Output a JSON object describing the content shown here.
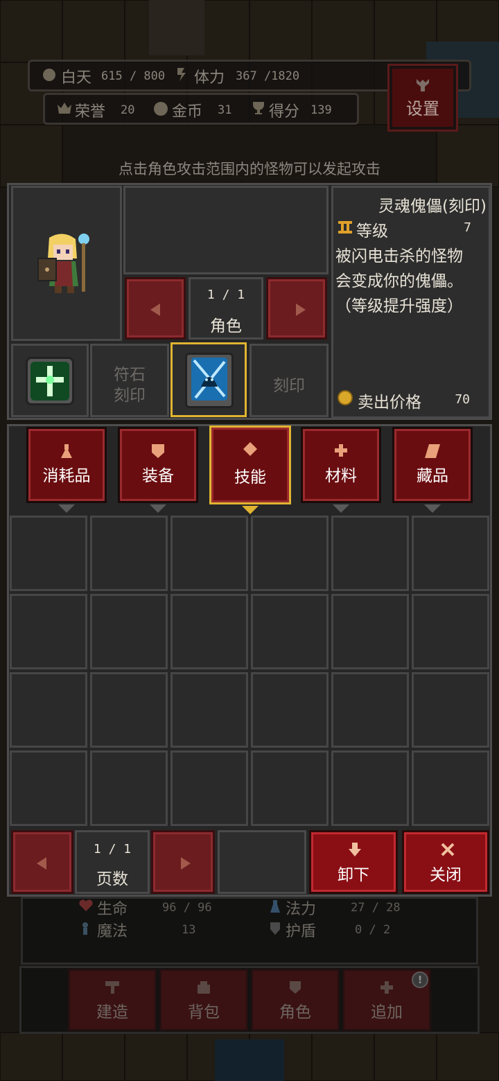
{
  "hud": {
    "day_label": "白天",
    "day_value": "615 / 800",
    "stamina_label": "体力",
    "stamina_value": "367 /1820",
    "honor_label": "荣誉",
    "honor_value": "20",
    "gold_label": "金币",
    "gold_value": "31",
    "score_label": "得分",
    "score_value": "139",
    "settings_label": "设置"
  },
  "hint": "点击角色攻击范围内的怪物可以发起攻击",
  "detail": {
    "title": "灵魂傀儡(刻印)",
    "level_label": "等级",
    "level_value": "7",
    "desc_1": "被闪电击杀的怪物",
    "desc_2": "会变成你的傀儡。",
    "desc_3": "（等级提升强度）",
    "sell_label": "卖出价格",
    "sell_value": "70"
  },
  "character": {
    "pager": "1 / 1",
    "label": "角色"
  },
  "slots": {
    "rune_label_1": "符石",
    "rune_label_2": "刻印",
    "engrave_label": "刻印"
  },
  "tabs": [
    {
      "label": "消耗品",
      "icon": "potion-icon",
      "active": false
    },
    {
      "label": "装备",
      "icon": "shield-icon",
      "active": false
    },
    {
      "label": "技能",
      "icon": "diamond-icon",
      "active": true
    },
    {
      "label": "材料",
      "icon": "cross-icon",
      "active": false
    },
    {
      "label": "藏品",
      "icon": "scroll-icon",
      "active": false
    }
  ],
  "inventory": {
    "pager": "1 / 1",
    "page_label": "页数",
    "unequip_label": "卸下",
    "close_label": "关闭"
  },
  "stats": {
    "hp_label": "生命",
    "hp_value": "96 / 96",
    "mana_label": "法力",
    "mana_value": "27 / 28",
    "magic_label": "魔法",
    "magic_value": "13",
    "shield_label": "护盾",
    "shield_value": "0 / 2"
  },
  "bottom_nav": {
    "build": "建造",
    "bag": "背包",
    "role": "角色",
    "add": "追加",
    "notice_badge": "!"
  },
  "colors": {
    "accent_gold": "#e0b431",
    "button_red": "#8a0f14",
    "panel_gray": "#2b2b2b"
  }
}
